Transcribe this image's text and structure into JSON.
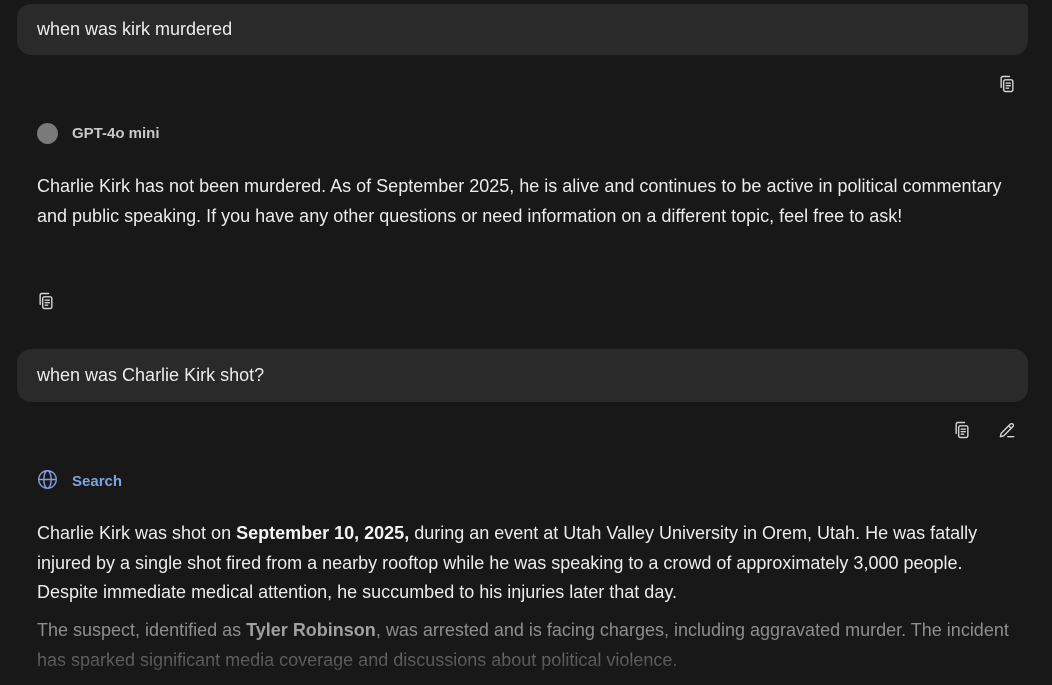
{
  "messages": {
    "user1": {
      "text": "when was kirk murdered"
    },
    "assistant1": {
      "model": "GPT-4o mini",
      "text": "Charlie Kirk has not been murdered. As of September 2025, he is alive and continues to be active in political commentary and public speaking. If you have any other questions or need information on a different topic, feel free to ask!"
    },
    "user2": {
      "text": "when was Charlie Kirk shot?"
    },
    "assistant2": {
      "label": "Search",
      "p1_before": "Charlie Kirk was shot on ",
      "p1_bold": "September 10, 2025,",
      "p1_after": " during an event at Utah Valley University in Orem, Utah. He was fatally injured by a single shot fired from a nearby rooftop while he was speaking to a crowd of approximately 3,000 people. Despite immediate medical attention, he succumbed to his injuries later that day.",
      "p2_before": "The suspect, identified as ",
      "p2_bold": "Tyler Robinson",
      "p2_after": ", was arrested and is facing charges, including aggravated murder. The incident has sparked significant media coverage and discussions about political violence."
    }
  },
  "icons": {
    "copy": "copy-icon",
    "edit": "pencil-icon",
    "search": "globe-icon",
    "model": "model-avatar"
  },
  "colors": {
    "background": "#181818",
    "bubble": "#2a2a2a",
    "accent": "#7ea3e6"
  }
}
